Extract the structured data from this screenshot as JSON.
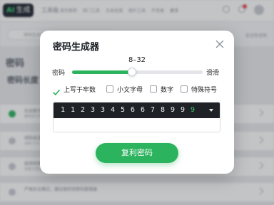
{
  "background": {
    "brand": {
      "ai": "AI",
      "name": "生成",
      "suffix": "工具箱"
    },
    "nav": [
      "首页推荐",
      "热门工具",
      "文本处理",
      "图片工具",
      "开发者",
      "更多"
    ],
    "sub_chip": "密码生成工具 · 在线随机密码",
    "sub_right": "安全性说明",
    "page_heading": "密码",
    "length_heading": "密码长度",
    "rows": [
      {
        "title": "包含数字与字母组合",
        "desc": "推荐用于常规账号",
        "on": true
      },
      {
        "title": "排除易混淆字符",
        "desc": "去除 0 O l 1 等字符",
        "on": false
      },
      {
        "title": "使用特殊符号增强",
        "desc": "适用于高安全场景",
        "on": false
      },
      {
        "title": "严格安全模式，建议保存到密码管理器",
        "desc": "",
        "on": false
      }
    ]
  },
  "modal": {
    "title": "密码生成器",
    "range_label": "8–32",
    "left_label": "密码",
    "right_label": "滑滑",
    "slider": {
      "min": 8,
      "max": 32,
      "value": 19
    },
    "options": [
      {
        "label": "上写于牢数",
        "checked": true
      },
      {
        "label": "小文字母",
        "checked": false
      },
      {
        "label": "数字",
        "checked": false
      },
      {
        "label": "特殊符号",
        "checked": false
      }
    ],
    "output_digits": [
      "1",
      "1",
      "2",
      "3",
      "3",
      "4",
      "5",
      "6",
      "6",
      "7",
      "8",
      "9",
      "9",
      "9"
    ],
    "output_value": "",
    "button_label": "复利密码"
  },
  "colors": {
    "accent": "#2bb35e",
    "output_bg": "#1e2227",
    "accent_digit": "#3ec46d"
  },
  "icons": {
    "close": "close-icon",
    "dropdown": "chevron-down-icon",
    "check": "check-icon"
  }
}
